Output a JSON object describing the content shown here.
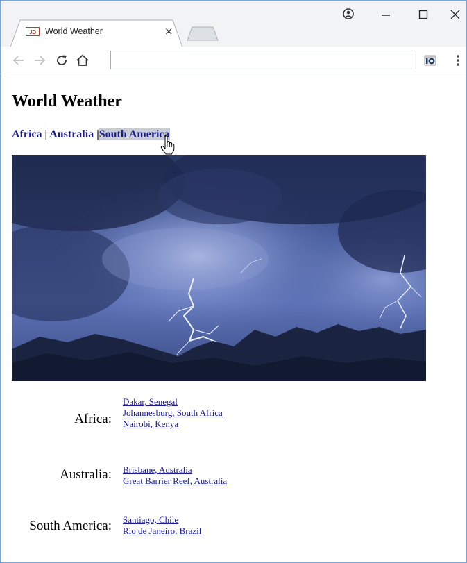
{
  "browser": {
    "tab_title": "World Weather",
    "tab_favicon_text": "JD",
    "tab_close": "×",
    "address_value": "",
    "accent_colors": {
      "favicon": "#c0392b",
      "link": "#1a1a9a",
      "nav_link": "#1a1a8a"
    }
  },
  "page": {
    "title": "World Weather",
    "nav": {
      "africa": "Africa",
      "australia": "Australia",
      "south_america": "South America",
      "separator": "|",
      "hovered_item": "south_america"
    },
    "hero_image": "lightning-storm-over-mountains",
    "regions": [
      {
        "label": "Africa:",
        "cities": [
          "Dakar, Senegal",
          "Johannesburg, South Africa",
          "Nairobi, Kenya"
        ]
      },
      {
        "label": "Australia:",
        "cities": [
          "Brisbane, Australia",
          "Great Barrier Reef, Australia"
        ]
      },
      {
        "label": "South America:",
        "cities": [
          "Santiago, Chile",
          "Rio de Janeiro, Brazil"
        ]
      }
    ]
  }
}
